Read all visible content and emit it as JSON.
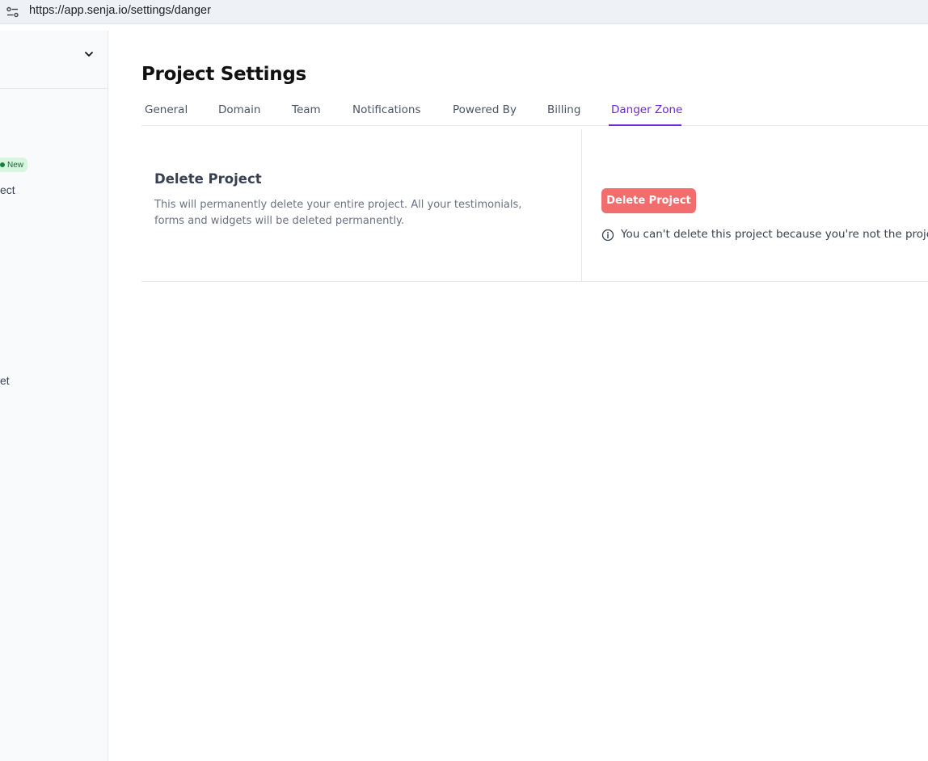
{
  "browser": {
    "url": "https://app.senja.io/settings/danger",
    "site_icon": "tune-icon"
  },
  "sidebar": {
    "header_icon": "chevron-down-icon",
    "badge": "New",
    "item_project_fragment": "ect",
    "item_lower_fragment": "et"
  },
  "page": {
    "title": "Project Settings"
  },
  "tabs": [
    {
      "label": "General"
    },
    {
      "label": "Domain"
    },
    {
      "label": "Team"
    },
    {
      "label": "Notifications"
    },
    {
      "label": "Powered By"
    },
    {
      "label": "Billing"
    },
    {
      "label": "Danger Zone",
      "active": true
    }
  ],
  "danger": {
    "section_title": "Delete Project",
    "description": "This will permanently delete your entire project. All your testimonials, forms and widgets will be deleted permanently.",
    "button_label": "Delete Project",
    "info_icon": "info-icon",
    "info_message": "You can't delete this project because you're not the project"
  },
  "colors": {
    "accent": "#6d28d9",
    "danger_button": "#f26d6d",
    "badge_bg": "#d8f5df"
  }
}
